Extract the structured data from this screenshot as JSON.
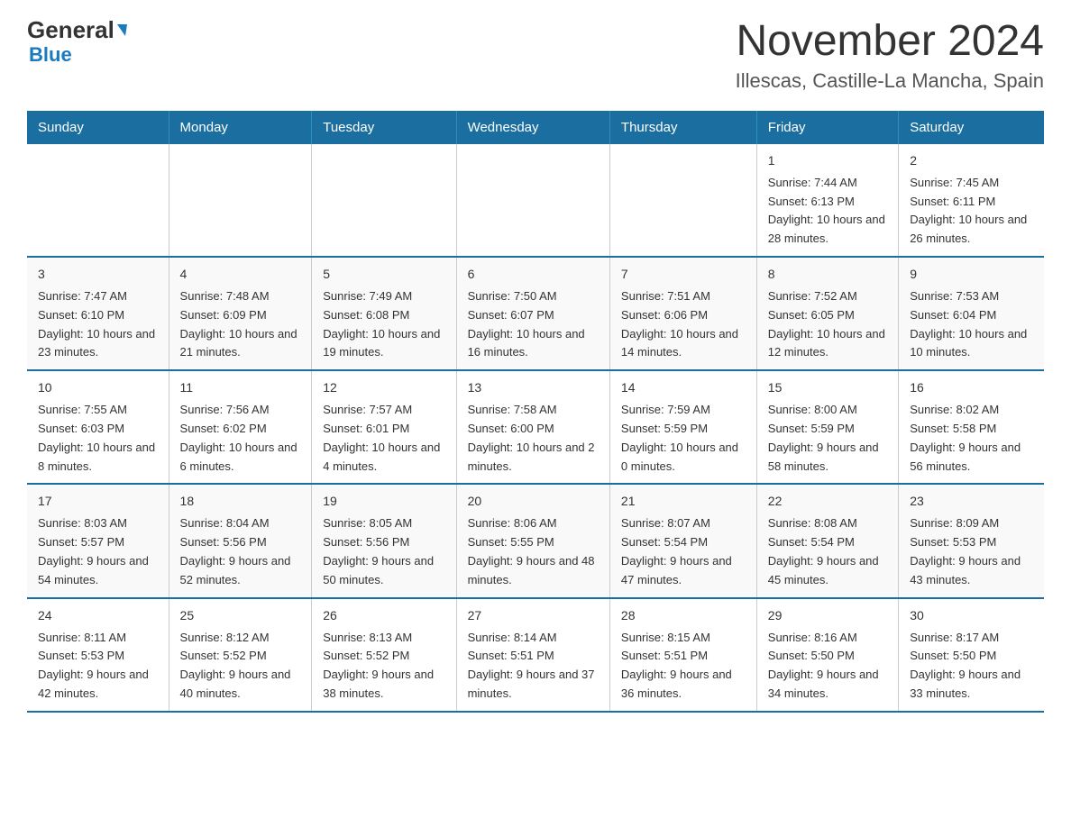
{
  "logo": {
    "general": "General",
    "arrow": "▶",
    "blue": "Blue"
  },
  "title": "November 2024",
  "subtitle": "Illescas, Castille-La Mancha, Spain",
  "weekdays": [
    "Sunday",
    "Monday",
    "Tuesday",
    "Wednesday",
    "Thursday",
    "Friday",
    "Saturday"
  ],
  "weeks": [
    [
      {
        "day": "",
        "sunrise": "",
        "sunset": "",
        "daylight": ""
      },
      {
        "day": "",
        "sunrise": "",
        "sunset": "",
        "daylight": ""
      },
      {
        "day": "",
        "sunrise": "",
        "sunset": "",
        "daylight": ""
      },
      {
        "day": "",
        "sunrise": "",
        "sunset": "",
        "daylight": ""
      },
      {
        "day": "",
        "sunrise": "",
        "sunset": "",
        "daylight": ""
      },
      {
        "day": "1",
        "sunrise": "Sunrise: 7:44 AM",
        "sunset": "Sunset: 6:13 PM",
        "daylight": "Daylight: 10 hours and 28 minutes."
      },
      {
        "day": "2",
        "sunrise": "Sunrise: 7:45 AM",
        "sunset": "Sunset: 6:11 PM",
        "daylight": "Daylight: 10 hours and 26 minutes."
      }
    ],
    [
      {
        "day": "3",
        "sunrise": "Sunrise: 7:47 AM",
        "sunset": "Sunset: 6:10 PM",
        "daylight": "Daylight: 10 hours and 23 minutes."
      },
      {
        "day": "4",
        "sunrise": "Sunrise: 7:48 AM",
        "sunset": "Sunset: 6:09 PM",
        "daylight": "Daylight: 10 hours and 21 minutes."
      },
      {
        "day": "5",
        "sunrise": "Sunrise: 7:49 AM",
        "sunset": "Sunset: 6:08 PM",
        "daylight": "Daylight: 10 hours and 19 minutes."
      },
      {
        "day": "6",
        "sunrise": "Sunrise: 7:50 AM",
        "sunset": "Sunset: 6:07 PM",
        "daylight": "Daylight: 10 hours and 16 minutes."
      },
      {
        "day": "7",
        "sunrise": "Sunrise: 7:51 AM",
        "sunset": "Sunset: 6:06 PM",
        "daylight": "Daylight: 10 hours and 14 minutes."
      },
      {
        "day": "8",
        "sunrise": "Sunrise: 7:52 AM",
        "sunset": "Sunset: 6:05 PM",
        "daylight": "Daylight: 10 hours and 12 minutes."
      },
      {
        "day": "9",
        "sunrise": "Sunrise: 7:53 AM",
        "sunset": "Sunset: 6:04 PM",
        "daylight": "Daylight: 10 hours and 10 minutes."
      }
    ],
    [
      {
        "day": "10",
        "sunrise": "Sunrise: 7:55 AM",
        "sunset": "Sunset: 6:03 PM",
        "daylight": "Daylight: 10 hours and 8 minutes."
      },
      {
        "day": "11",
        "sunrise": "Sunrise: 7:56 AM",
        "sunset": "Sunset: 6:02 PM",
        "daylight": "Daylight: 10 hours and 6 minutes."
      },
      {
        "day": "12",
        "sunrise": "Sunrise: 7:57 AM",
        "sunset": "Sunset: 6:01 PM",
        "daylight": "Daylight: 10 hours and 4 minutes."
      },
      {
        "day": "13",
        "sunrise": "Sunrise: 7:58 AM",
        "sunset": "Sunset: 6:00 PM",
        "daylight": "Daylight: 10 hours and 2 minutes."
      },
      {
        "day": "14",
        "sunrise": "Sunrise: 7:59 AM",
        "sunset": "Sunset: 5:59 PM",
        "daylight": "Daylight: 10 hours and 0 minutes."
      },
      {
        "day": "15",
        "sunrise": "Sunrise: 8:00 AM",
        "sunset": "Sunset: 5:59 PM",
        "daylight": "Daylight: 9 hours and 58 minutes."
      },
      {
        "day": "16",
        "sunrise": "Sunrise: 8:02 AM",
        "sunset": "Sunset: 5:58 PM",
        "daylight": "Daylight: 9 hours and 56 minutes."
      }
    ],
    [
      {
        "day": "17",
        "sunrise": "Sunrise: 8:03 AM",
        "sunset": "Sunset: 5:57 PM",
        "daylight": "Daylight: 9 hours and 54 minutes."
      },
      {
        "day": "18",
        "sunrise": "Sunrise: 8:04 AM",
        "sunset": "Sunset: 5:56 PM",
        "daylight": "Daylight: 9 hours and 52 minutes."
      },
      {
        "day": "19",
        "sunrise": "Sunrise: 8:05 AM",
        "sunset": "Sunset: 5:56 PM",
        "daylight": "Daylight: 9 hours and 50 minutes."
      },
      {
        "day": "20",
        "sunrise": "Sunrise: 8:06 AM",
        "sunset": "Sunset: 5:55 PM",
        "daylight": "Daylight: 9 hours and 48 minutes."
      },
      {
        "day": "21",
        "sunrise": "Sunrise: 8:07 AM",
        "sunset": "Sunset: 5:54 PM",
        "daylight": "Daylight: 9 hours and 47 minutes."
      },
      {
        "day": "22",
        "sunrise": "Sunrise: 8:08 AM",
        "sunset": "Sunset: 5:54 PM",
        "daylight": "Daylight: 9 hours and 45 minutes."
      },
      {
        "day": "23",
        "sunrise": "Sunrise: 8:09 AM",
        "sunset": "Sunset: 5:53 PM",
        "daylight": "Daylight: 9 hours and 43 minutes."
      }
    ],
    [
      {
        "day": "24",
        "sunrise": "Sunrise: 8:11 AM",
        "sunset": "Sunset: 5:53 PM",
        "daylight": "Daylight: 9 hours and 42 minutes."
      },
      {
        "day": "25",
        "sunrise": "Sunrise: 8:12 AM",
        "sunset": "Sunset: 5:52 PM",
        "daylight": "Daylight: 9 hours and 40 minutes."
      },
      {
        "day": "26",
        "sunrise": "Sunrise: 8:13 AM",
        "sunset": "Sunset: 5:52 PM",
        "daylight": "Daylight: 9 hours and 38 minutes."
      },
      {
        "day": "27",
        "sunrise": "Sunrise: 8:14 AM",
        "sunset": "Sunset: 5:51 PM",
        "daylight": "Daylight: 9 hours and 37 minutes."
      },
      {
        "day": "28",
        "sunrise": "Sunrise: 8:15 AM",
        "sunset": "Sunset: 5:51 PM",
        "daylight": "Daylight: 9 hours and 36 minutes."
      },
      {
        "day": "29",
        "sunrise": "Sunrise: 8:16 AM",
        "sunset": "Sunset: 5:50 PM",
        "daylight": "Daylight: 9 hours and 34 minutes."
      },
      {
        "day": "30",
        "sunrise": "Sunrise: 8:17 AM",
        "sunset": "Sunset: 5:50 PM",
        "daylight": "Daylight: 9 hours and 33 minutes."
      }
    ]
  ]
}
